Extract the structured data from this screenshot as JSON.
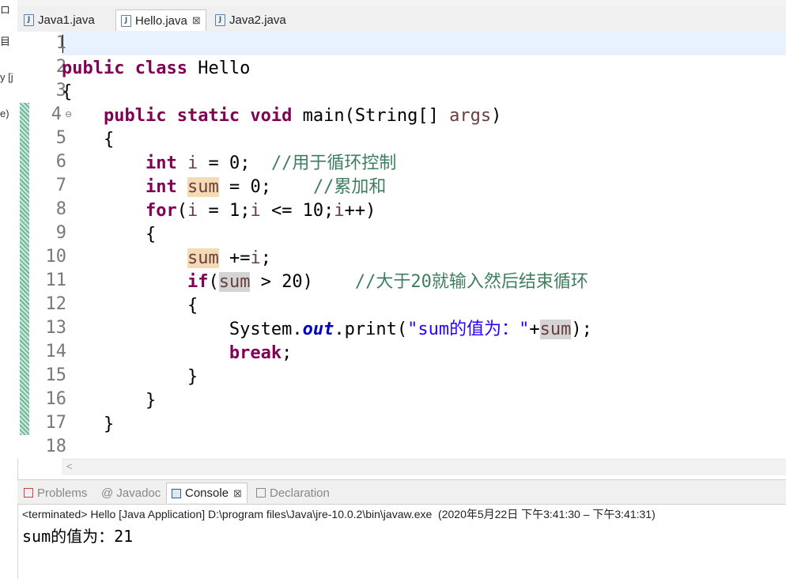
{
  "left_strip": {
    "fragments": [
      "ロ",
      "目",
      "y [j",
      "e)"
    ]
  },
  "editor_tabs": [
    {
      "label": "Java1.java"
    },
    {
      "label": "Hello.java",
      "active": true
    },
    {
      "label": "Java2.java"
    }
  ],
  "close_glyph": "⊠",
  "line_numbers": [
    "1",
    "2",
    "3",
    "4",
    "5",
    "6",
    "7",
    "8",
    "9",
    "10",
    "11",
    "12",
    "13",
    "14",
    "15",
    "16",
    "17",
    "18"
  ],
  "code": {
    "l2a": "public class",
    "l2b": " Hello",
    "l3": "{",
    "l4a": "    ",
    "l4b": "public static void",
    "l4c": " main(String[] ",
    "l4d": "args",
    "l4e": ")",
    "l5": "    {",
    "l6a": "        ",
    "l6b": "int",
    "l6c": " ",
    "l6d": "i",
    "l6e": " = 0;  ",
    "l6f": "//用于循环控制",
    "l7a": "        ",
    "l7b": "int",
    "l7c": " ",
    "l7d": "sum",
    "l7e": " = 0;    ",
    "l7f": "//累加和",
    "l8a": "        ",
    "l8b": "for",
    "l8c": "(",
    "l8d": "i",
    "l8e": " = 1;",
    "l8f": "i",
    "l8g": " <= 10;",
    "l8h": "i",
    "l8i": "++)",
    "l9": "        {",
    "l10a": "            ",
    "l10b": "sum",
    "l10c": " +=",
    "l10d": "i",
    "l10e": ";",
    "l11a": "            ",
    "l11b": "if",
    "l11c": "(",
    "l11d": "sum",
    "l11e": " > 20)    ",
    "l11f": "//大于20就输入然后结束循环",
    "l12": "            {",
    "l13a": "                System.",
    "l13b": "out",
    "l13c": ".print(",
    "l13d": "\"sum的值为：\"",
    "l13e": "+",
    "l13f": "sum",
    "l13g": ");",
    "l14a": "                ",
    "l14b": "break",
    "l14c": ";",
    "l15": "            }",
    "l16": "        }",
    "l17": "    }"
  },
  "hscroll_arrow": "<",
  "console_tabs": [
    {
      "label": "Problems"
    },
    {
      "label": "@ Javadoc"
    },
    {
      "label": "Console",
      "active": true
    },
    {
      "label": "Declaration"
    }
  ],
  "console": {
    "description": "<terminated> Hello [Java Application] D:\\program files\\Java\\jre-10.0.2\\bin\\javaw.exe  (2020年5月22日 下午3:41:30 – 下午3:41:31)",
    "output": "sum的值为：21"
  },
  "colors": {
    "keyword": "#7f0055",
    "comment": "#3f7f5f",
    "string": "#2a00ff",
    "field": "#0000c0",
    "local_var": "#6a3e3e"
  }
}
